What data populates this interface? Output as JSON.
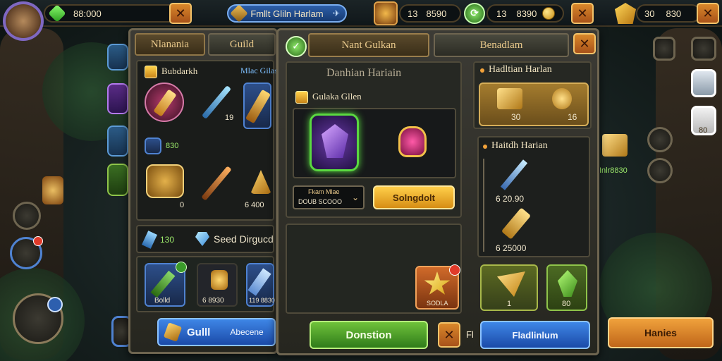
{
  "topbar": {
    "currency_1": "88:000",
    "title_banner": "Fmllt Gliln Harlam",
    "counter_1": "13",
    "counter_2": "8590",
    "counter_3": "13",
    "counter_4": "8390",
    "counter_5": "30",
    "counter_6": "830"
  },
  "left_panel": {
    "tabs": [
      "Nlanania",
      "Guild"
    ],
    "section_title": "Bubdarkh",
    "section_tag": "Mlac Gilas",
    "item_small_label": "830",
    "item_values": [
      "19",
      "0",
      "6 400"
    ],
    "stat_value": "130",
    "seed_label": "Seed Dirgucd",
    "bottom_slots": [
      "Bolld",
      "6 8930",
      "119 8830"
    ],
    "guild_button": "Gulll",
    "guild_button_tail": "Abecene"
  },
  "center_panel": {
    "tabs": [
      "Nant Gulkan",
      "Benadlam"
    ],
    "header": "Danhian Hariain",
    "subheader": "Gulaka Gllen",
    "dropdown_label": "Fkam Mlae",
    "dropdown_value": "DOUB SCOOO",
    "select_button": "Solngdolt",
    "star_label": "SODLA",
    "donation_button": "Donstion",
    "after_x_text": "Fl"
  },
  "right_panel": {
    "header_1": "Hadltian Harlan",
    "top_values": [
      "30",
      "16"
    ],
    "header_2": "Haitdh Harian",
    "list_values": [
      "6 20.90",
      "6 25000"
    ],
    "bottom_values": [
      "1",
      "80"
    ],
    "premium_button": "Fladlinlum"
  },
  "far_right": {
    "hanies_button": "Hanies",
    "side_label": "80",
    "side_tag": "Inlr8830"
  },
  "colors": {
    "accent_gold": "#d6ae58",
    "accent_blue": "#4f82d1",
    "accent_green": "#8fc44a",
    "close_orange": "#d9872a"
  },
  "icons": {
    "close": "close-icon",
    "gem": "gem-icon",
    "coin": "coin-icon",
    "crystal": "crystal-icon",
    "star": "star-icon",
    "scroll": "scroll-icon",
    "sword": "sword-icon",
    "shield": "shield-icon"
  }
}
